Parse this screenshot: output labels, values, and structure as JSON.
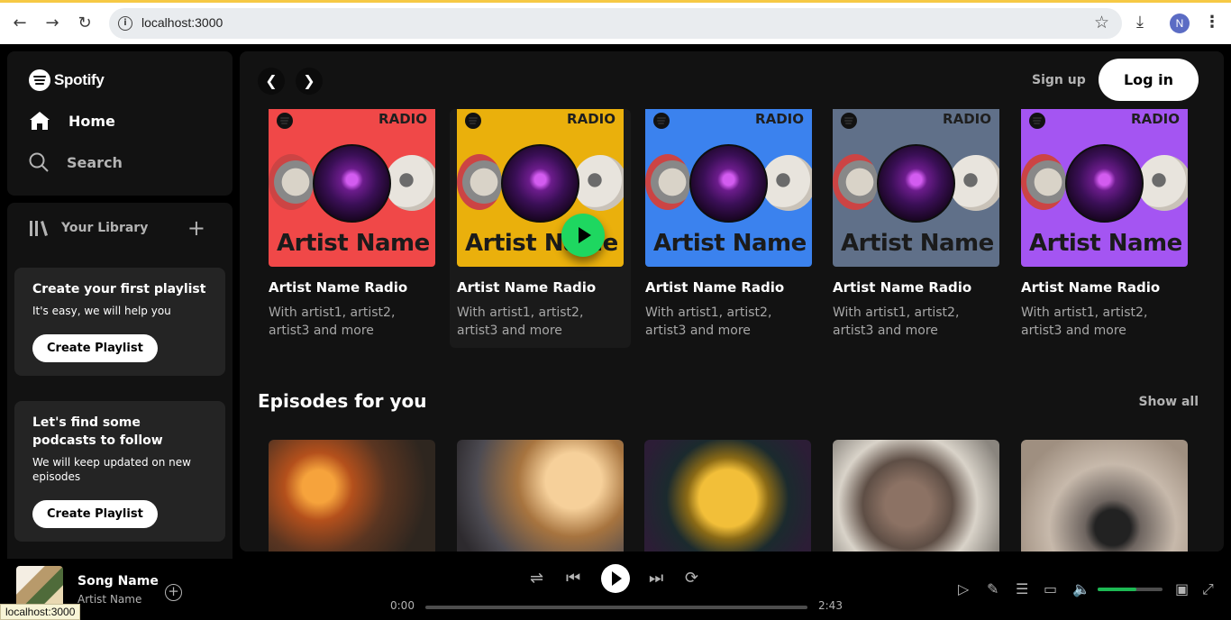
{
  "browser": {
    "url": "localhost:3000",
    "avatar_letter": "N",
    "status_tip": "localhost:3000"
  },
  "sidebar": {
    "logo_text": "Spotify",
    "nav": [
      {
        "label": "Home",
        "icon": "home-icon"
      },
      {
        "label": "Search",
        "icon": "search-icon"
      }
    ],
    "library_label": "Your Library",
    "cards": [
      {
        "title": "Create your first playlist",
        "text": "It's easy, we will help you",
        "button": "Create Playlist"
      },
      {
        "title": "Let's find some podcasts to follow",
        "text": "We will keep updated on new episodes",
        "button": "Create Playlist"
      }
    ]
  },
  "header": {
    "signup": "Sign up",
    "login": "Log in"
  },
  "radio_cards": [
    {
      "badge": "RADIO",
      "art_name": "Artist Name",
      "title": "Artist Name Radio",
      "subtitle": "With artist1, artist2, artist3 and more",
      "color": "#f04848"
    },
    {
      "badge": "RADIO",
      "art_name": "Artist Name",
      "title": "Artist Name Radio",
      "subtitle": "With artist1, artist2, artist3 and more",
      "color": "#eab00c"
    },
    {
      "badge": "RADIO",
      "art_name": "Artist Name",
      "title": "Artist Name Radio",
      "subtitle": "With artist1, artist2, artist3 and more",
      "color": "#3b82ee"
    },
    {
      "badge": "RADIO",
      "art_name": "Artist Name",
      "title": "Artist Name Radio",
      "subtitle": "With artist1, artist2, artist3 and more",
      "color": "#607089"
    },
    {
      "badge": "RADIO",
      "art_name": "Artist Name",
      "title": "Artist Name Radio",
      "subtitle": "With artist1, artist2, artist3 and more",
      "color": "#a455f2"
    }
  ],
  "episodes": {
    "title": "Episodes for you",
    "show_all": "Show all"
  },
  "player": {
    "song": "Song Name",
    "artist": "Artist Name",
    "elapsed": "0:00",
    "duration": "2:43",
    "progress": 0,
    "volume": 0.6,
    "accent": "#1db954"
  }
}
